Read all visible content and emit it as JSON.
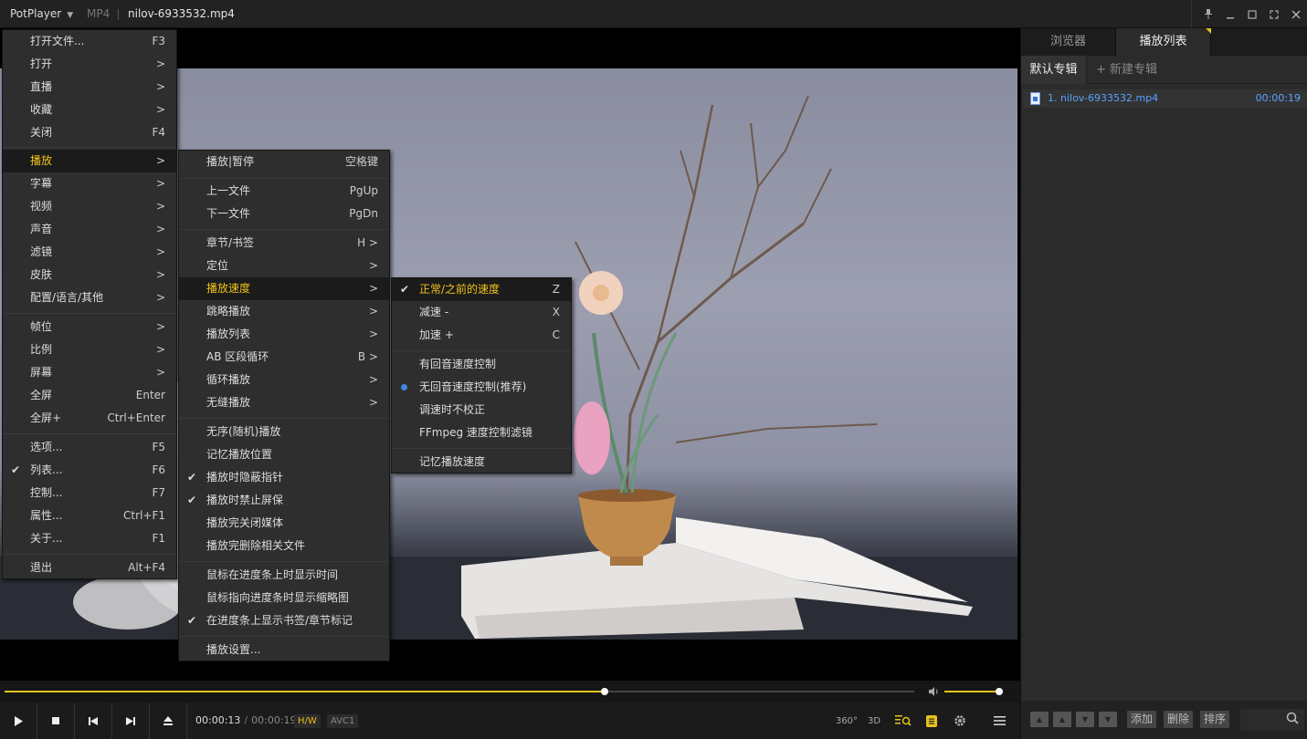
{
  "titlebar": {
    "app_name": "PotPlayer",
    "format": "MP4",
    "filename": "nilov-6933532.mp4"
  },
  "colors": {
    "accent": "#e8c21c",
    "highlight_text": "#f2c218",
    "playlist_link": "#5aa2ff",
    "radio_dot": "#3f86e8"
  },
  "main_menu": [
    {
      "label": "打开文件...",
      "shortcut": "F3"
    },
    {
      "label": "打开",
      "shortcut": ">"
    },
    {
      "label": "直播",
      "shortcut": ">"
    },
    {
      "label": "收藏",
      "shortcut": ">"
    },
    {
      "label": "关闭",
      "shortcut": "F4"
    },
    {
      "label": "播放",
      "shortcut": ">",
      "highlighted": true
    },
    {
      "label": "字幕",
      "shortcut": ">"
    },
    {
      "label": "视频",
      "shortcut": ">"
    },
    {
      "label": "声音",
      "shortcut": ">"
    },
    {
      "label": "滤镜",
      "shortcut": ">"
    },
    {
      "label": "皮肤",
      "shortcut": ">"
    },
    {
      "label": "配置/语言/其他",
      "shortcut": ">"
    },
    {
      "label": "帧位",
      "shortcut": ">"
    },
    {
      "label": "比例",
      "shortcut": ">"
    },
    {
      "label": "屏幕",
      "shortcut": ">"
    },
    {
      "label": "全屏",
      "shortcut": "Enter"
    },
    {
      "label": "全屏+",
      "shortcut": "Ctrl+Enter"
    },
    {
      "label": "选项...",
      "shortcut": "F5"
    },
    {
      "label": "列表...",
      "shortcut": "F6",
      "checked": true
    },
    {
      "label": "控制...",
      "shortcut": "F7"
    },
    {
      "label": "属性...",
      "shortcut": "Ctrl+F1"
    },
    {
      "label": "关于...",
      "shortcut": "F1"
    },
    {
      "label": "退出",
      "shortcut": "Alt+F4"
    }
  ],
  "play_menu": [
    {
      "label": "播放|暂停",
      "shortcut": "空格键"
    },
    {
      "label": "上一文件",
      "shortcut": "PgUp"
    },
    {
      "label": "下一文件",
      "shortcut": "PgDn"
    },
    {
      "label": "章节/书签",
      "shortcut": "H >"
    },
    {
      "label": "定位",
      "shortcut": ">"
    },
    {
      "label": "播放速度",
      "shortcut": ">",
      "highlighted": true
    },
    {
      "label": "跳略播放",
      "shortcut": ">"
    },
    {
      "label": "播放列表",
      "shortcut": ">"
    },
    {
      "label": "AB 区段循环",
      "shortcut": "B >"
    },
    {
      "label": "循环播放",
      "shortcut": ">"
    },
    {
      "label": "无缝播放",
      "shortcut": ">"
    },
    {
      "label": "无序(随机)播放",
      "shortcut": ""
    },
    {
      "label": "记忆播放位置",
      "shortcut": ""
    },
    {
      "label": "播放时隐蔽指针",
      "shortcut": "",
      "checked": true
    },
    {
      "label": "播放时禁止屏保",
      "shortcut": "",
      "checked": true
    },
    {
      "label": "播放完关闭媒体",
      "shortcut": ""
    },
    {
      "label": "播放完删除相关文件",
      "shortcut": ""
    },
    {
      "label": "鼠标在进度条上时显示时间",
      "shortcut": ""
    },
    {
      "label": "鼠标指向进度条时显示缩略图",
      "shortcut": ""
    },
    {
      "label": "在进度条上显示书签/章节标记",
      "shortcut": "",
      "checked": true
    },
    {
      "label": "播放设置...",
      "shortcut": ""
    }
  ],
  "speed_menu": [
    {
      "label": "正常/之前的速度",
      "shortcut": "Z",
      "checked": true,
      "highlighted": true
    },
    {
      "label": "减速 -",
      "shortcut": "X"
    },
    {
      "label": "加速 +",
      "shortcut": "C"
    },
    {
      "label": "有回音速度控制",
      "shortcut": ""
    },
    {
      "label": "无回音速度控制(推荐)",
      "shortcut": "",
      "radio": true
    },
    {
      "label": "调速时不校正",
      "shortcut": ""
    },
    {
      "label": "FFmpeg 速度控制滤镜",
      "shortcut": ""
    },
    {
      "label": "记忆播放速度",
      "shortcut": ""
    }
  ],
  "playback": {
    "current_time": "00:00:13",
    "total_time": "00:00:19",
    "separator": "/",
    "progress_fraction": 0.66,
    "volume_fraction": 0.97,
    "hw_badge": "H/W",
    "codec_badge": "AVC1"
  },
  "controls": {
    "btn_360": "360°",
    "btn_3d": "3D"
  },
  "panel": {
    "tabs": [
      "浏览器",
      "播放列表"
    ],
    "active_tab": 1,
    "album_default": "默认专辑",
    "album_new": "+ 新建专辑",
    "items": [
      {
        "name": "1. nilov-6933532.mp4",
        "duration": "00:00:19"
      }
    ],
    "footer": {
      "add": "添加",
      "delete": "删除",
      "sort": "排序"
    }
  }
}
